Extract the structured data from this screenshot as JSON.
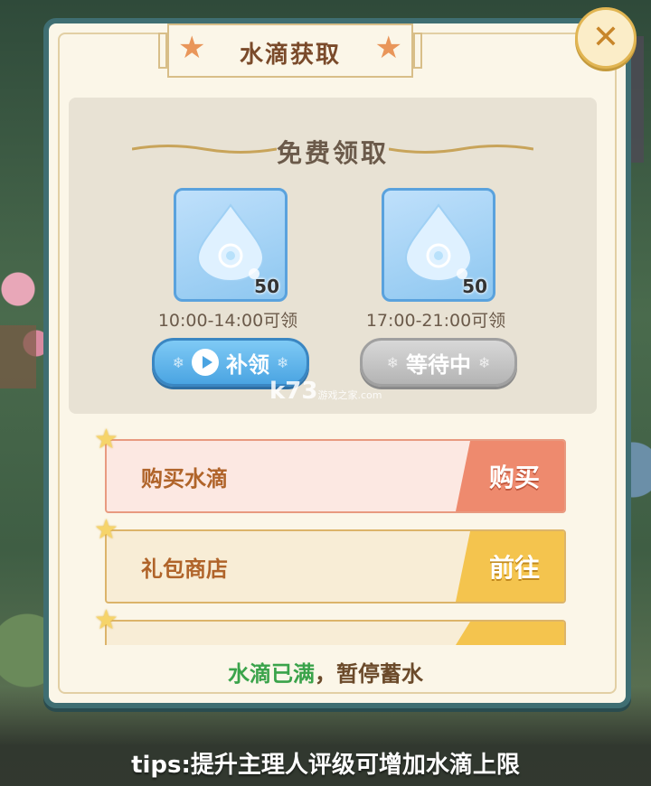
{
  "dialog": {
    "title": "水滴获取",
    "close_icon": "close-icon"
  },
  "free_claim": {
    "title": "免费领取",
    "rewards": [
      {
        "item": "water-drop",
        "count": "50",
        "time": "10:00-14:00可领",
        "button": "补领",
        "button_state": "active"
      },
      {
        "item": "water-drop",
        "count": "50",
        "time": "17:00-21:00可领",
        "button": "等待中",
        "button_state": "disabled"
      }
    ]
  },
  "watermark": {
    "logo": "k73",
    "sub": "游戏之家",
    "url": ".com"
  },
  "shop_rows": [
    {
      "label": "购买水滴",
      "action": "购买",
      "color": "#ee8a6e"
    },
    {
      "label": "礼包商店",
      "action": "前往",
      "color": "#f4c44e"
    }
  ],
  "status": {
    "full": "水滴已满",
    "rest": "，暂停蓄水"
  },
  "tips": "tips:提升主理人评级可增加水滴上限"
}
